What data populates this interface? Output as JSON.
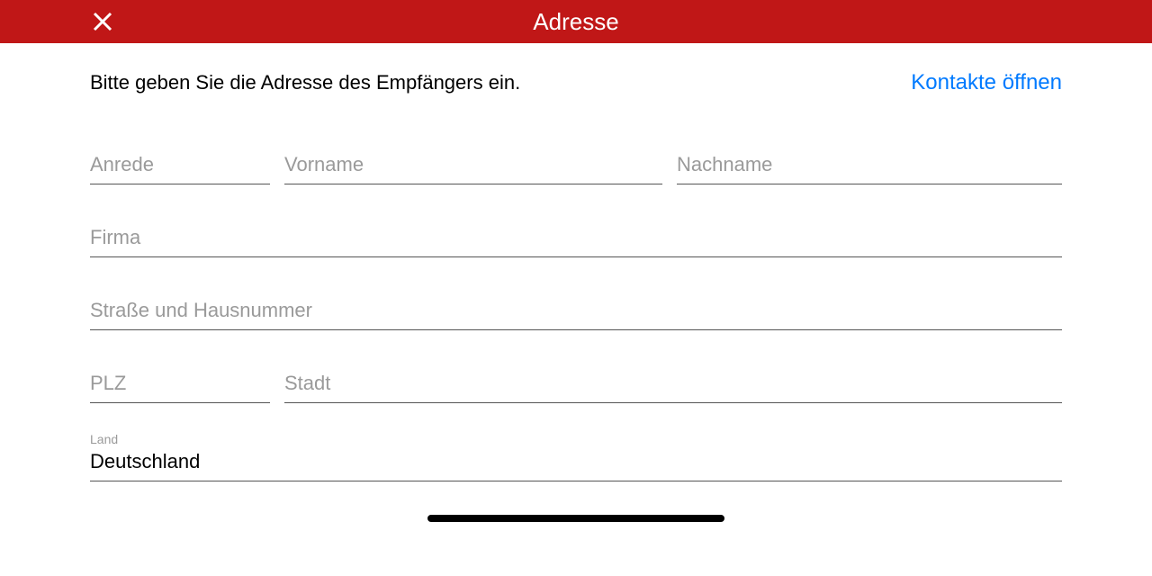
{
  "header": {
    "title": "Adresse"
  },
  "instruction": "Bitte geben Sie die Adresse des Empfängers ein.",
  "contacts_link": "Kontakte öffnen",
  "fields": {
    "anrede": {
      "placeholder": "Anrede",
      "value": ""
    },
    "vorname": {
      "placeholder": "Vorname",
      "value": ""
    },
    "nachname": {
      "placeholder": "Nachname",
      "value": ""
    },
    "firma": {
      "placeholder": "Firma",
      "value": ""
    },
    "strasse": {
      "placeholder": "Straße und Hausnummer",
      "value": ""
    },
    "plz": {
      "placeholder": "PLZ",
      "value": ""
    },
    "stadt": {
      "placeholder": "Stadt",
      "value": ""
    },
    "land": {
      "label": "Land",
      "value": "Deutschland"
    }
  }
}
